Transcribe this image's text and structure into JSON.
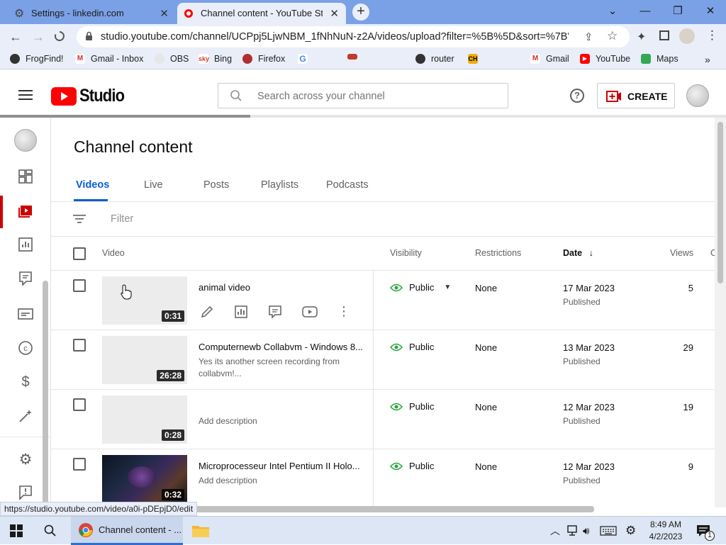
{
  "browser": {
    "tabs": [
      {
        "title": "Settings - linkedin.com",
        "active": false,
        "icon": "gear-icon"
      },
      {
        "title": "Channel content - YouTube Studi",
        "active": true,
        "icon": "youtube-studio-icon"
      }
    ],
    "new_tab": "+",
    "window_controls": [
      "⌄",
      "—",
      "❐",
      "✕"
    ],
    "url": "studio.youtube.com/channel/UCPpj5LjwNBM_1fNhNuN-z2A/videos/upload?filter=%5B%5D&sort=%7B\"col...",
    "bookmarks": [
      {
        "label": "FrogFind!",
        "color": "#333333",
        "glyph": "●"
      },
      {
        "label": "Gmail - Inbox",
        "color": "#d93025",
        "glyph": "M"
      },
      {
        "label": "OBS",
        "color": "#e0e0e0",
        "glyph": "○"
      },
      {
        "label": "Bing",
        "color": "#d93a2b",
        "glyph": "s"
      },
      {
        "label": "Firefox",
        "color": "#c0392b",
        "glyph": "◆"
      },
      {
        "label": "",
        "color": "#4285f4",
        "glyph": "G"
      },
      {
        "label": "",
        "color": "#c0392b",
        "glyph": "▭"
      },
      {
        "label": "router",
        "color": "#333333",
        "glyph": "●"
      },
      {
        "label": "",
        "color": "#f1b000",
        "glyph": "CH"
      },
      {
        "label": "Gmail",
        "color": "#d93025",
        "glyph": "M"
      },
      {
        "label": "YouTube",
        "color": "#ff0000",
        "glyph": "▶"
      },
      {
        "label": "Maps",
        "color": "#34a853",
        "glyph": "◆"
      }
    ],
    "bookmarks_more": "»",
    "status_url": "https://studio.youtube.com/video/a0i-pDEpjD0/edit"
  },
  "header": {
    "logo_text": "Studio",
    "search_placeholder": "Search across your channel",
    "create_label": "CREATE",
    "help": "?"
  },
  "page": {
    "title": "Channel content",
    "tabs": [
      "Videos",
      "Live",
      "Posts",
      "Playlists",
      "Podcasts"
    ],
    "active_tab": "Videos",
    "filter_placeholder": "Filter",
    "columns": {
      "video": "Video",
      "visibility": "Visibility",
      "restrictions": "Restrictions",
      "date": "Date",
      "date_sort": "↓",
      "views": "Views",
      "comments_partial": "C"
    }
  },
  "videos": [
    {
      "title": "animal video",
      "description": "",
      "duration": "0:31",
      "visibility": "Public",
      "restrictions": "None",
      "date": "17 Mar 2023",
      "status": "Published",
      "views": "5",
      "hovered": true
    },
    {
      "title": "Computernewb Collabvm - Windows 8...",
      "description": "Yes its another screen recording from collabvm!...",
      "duration": "26:28",
      "visibility": "Public",
      "restrictions": "None",
      "date": "13 Mar 2023",
      "status": "Published",
      "views": "29",
      "hovered": false
    },
    {
      "title": "",
      "description": "Add description",
      "duration": "0:28",
      "visibility": "Public",
      "restrictions": "None",
      "date": "12 Mar 2023",
      "status": "Published",
      "views": "19",
      "hovered": false
    },
    {
      "title": "Microprocesseur Intel Pentium II Holo...",
      "description": "Add description",
      "duration": "0:32",
      "visibility": "Public",
      "restrictions": "None",
      "date": "12 Mar 2023",
      "status": "Published",
      "views": "9",
      "hovered": false
    }
  ],
  "taskbar": {
    "active_window": "Channel content - ...",
    "time": "8:49 AM",
    "date": "4/2/2023",
    "notifications": "1"
  },
  "colors": {
    "accent": "#065fd4",
    "youtube_red": "#ff0000",
    "visibility_green": "#2ba640"
  }
}
